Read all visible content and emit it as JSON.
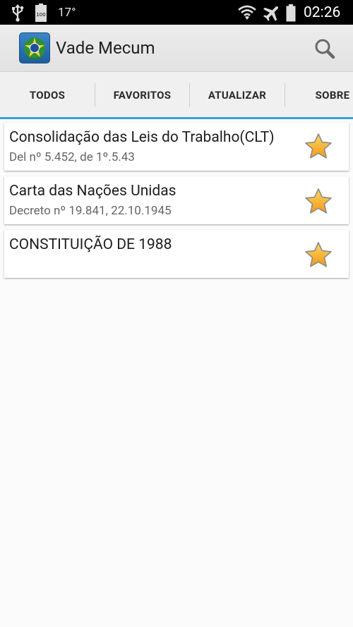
{
  "status_bar": {
    "battery_level": "100",
    "temperature": "17°",
    "time": "02:26"
  },
  "app_bar": {
    "title": "Vade Mecum"
  },
  "tabs": [
    {
      "label": "TODOS",
      "selected": false
    },
    {
      "label": "FAVORITOS",
      "selected": true
    },
    {
      "label": "ATUALIZAR",
      "selected": false
    },
    {
      "label": "SOBRE",
      "selected": false
    }
  ],
  "favorites": [
    {
      "title": "Consolidação das Leis do Trabalho(CLT)",
      "subtitle": "Del nº 5.452, de 1º.5.43",
      "starred": true
    },
    {
      "title": "Carta das Nações Unidas",
      "subtitle": "Decreto nº 19.841, 22.10.1945",
      "starred": true
    },
    {
      "title": "CONSTITUIÇÃO DE 1988",
      "subtitle": "",
      "starred": true
    }
  ],
  "colors": {
    "accent": "#33a0d8",
    "star_fill": "#f8b51e",
    "status_bar_bg": "#000000",
    "action_bar_bg": "#e8e8e8"
  }
}
